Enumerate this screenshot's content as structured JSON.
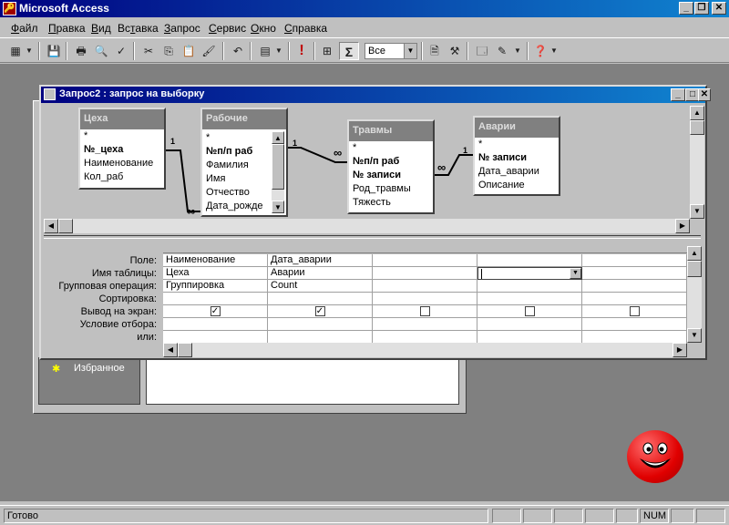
{
  "app": {
    "title": "Microsoft Access"
  },
  "menu": [
    "Файл",
    "Правка",
    "Вид",
    "Вставка",
    "Запрос",
    "Сервис",
    "Окно",
    "Справка"
  ],
  "menu_mnemonic": [
    "Ф",
    "П",
    "В",
    "т",
    "З",
    "С",
    "О",
    "С"
  ],
  "toolbar": {
    "top_values_combo": "Все",
    "sigma": "Σ",
    "run": "!"
  },
  "query_window": {
    "title": "Запрос2 : запрос на выборку"
  },
  "tables": [
    {
      "name": "Цеха",
      "fields": [
        "*",
        "№_цеха",
        "Наименование",
        "Кол_раб"
      ]
    },
    {
      "name": "Рабочие",
      "fields": [
        "*",
        "№п/п раб",
        "Фамилия",
        "Имя",
        "Отчество",
        "Дата_рожде"
      ]
    },
    {
      "name": "Травмы",
      "fields": [
        "*",
        "№п/п раб",
        "№ записи",
        "Род_травмы",
        "Тяжесть"
      ]
    },
    {
      "name": "Аварии",
      "fields": [
        "*",
        "№ записи",
        "Дата_аварии",
        "Описание"
      ]
    }
  ],
  "relations": {
    "one": "1",
    "many": "∞"
  },
  "grid": {
    "row_labels": [
      "Поле:",
      "Имя таблицы:",
      "Групповая операция:",
      "Сортировка:",
      "Вывод на экран:",
      "Условие отбора:",
      "или:"
    ],
    "columns": [
      {
        "field": "Наименование",
        "table": "Цеха",
        "group": "Группировка",
        "sort": "",
        "show": true
      },
      {
        "field": "Дата_аварии",
        "table": "Аварии",
        "group": "Count",
        "sort": "",
        "show": true
      },
      {
        "field": "",
        "table": "",
        "group": "",
        "sort": "",
        "show": false
      },
      {
        "field": "",
        "table": "",
        "group": "",
        "sort": "",
        "show": false
      },
      {
        "field": "",
        "table": "",
        "group": "",
        "sort": "",
        "show": false
      }
    ]
  },
  "db_window": {
    "favorites_label": "Избранное"
  },
  "status": {
    "text": "Готово",
    "num": "NUM"
  }
}
